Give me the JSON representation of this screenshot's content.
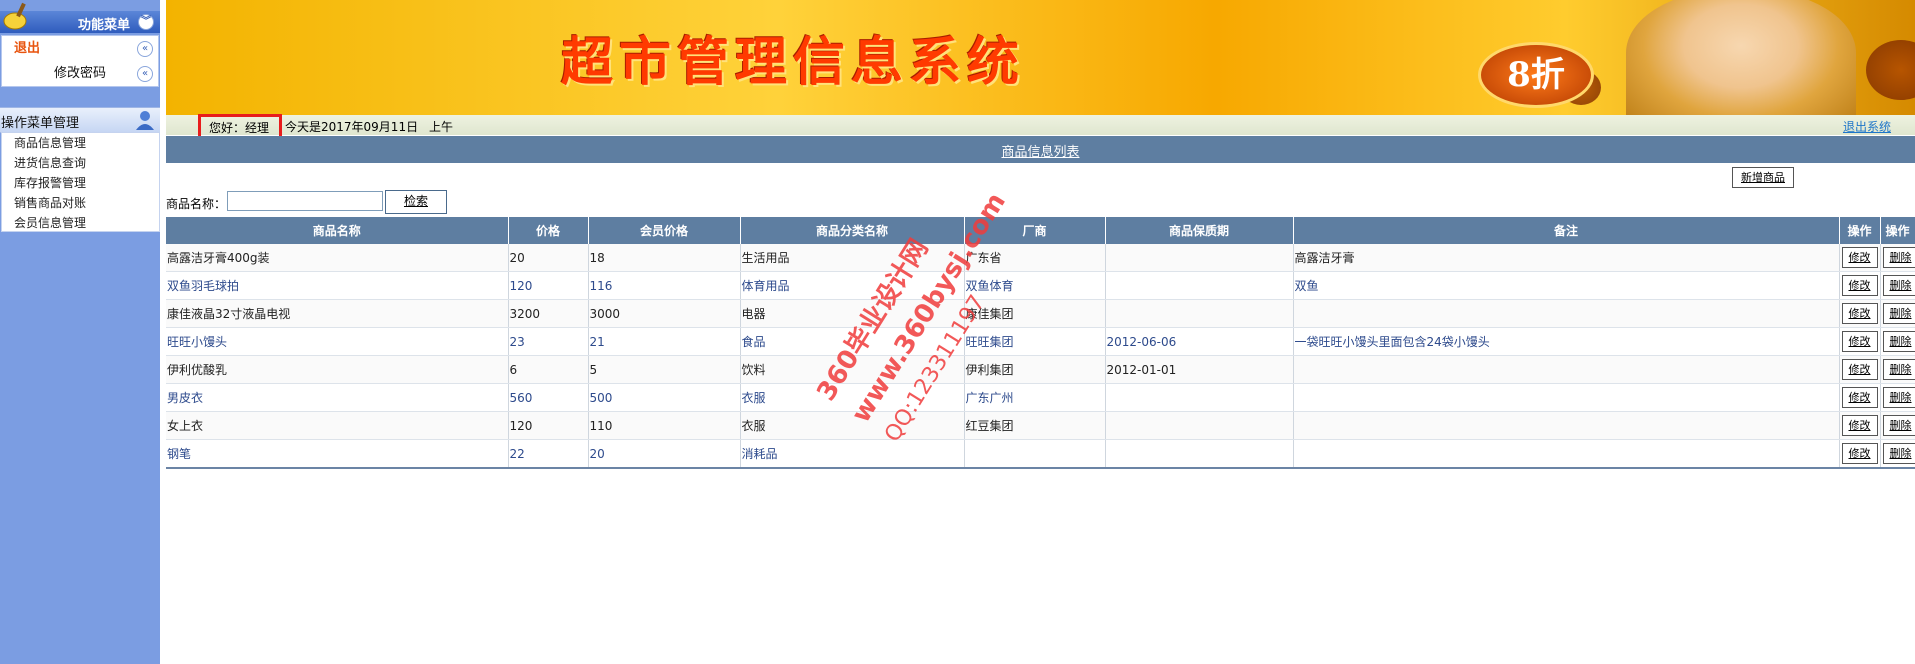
{
  "sidebar": {
    "function_menu_title": "功能菜单",
    "logout_label": "退出",
    "change_password_label": "修改密码",
    "op_menu_title": "操作菜单管理",
    "items": [
      {
        "label": "商品信息管理"
      },
      {
        "label": "进货信息查询"
      },
      {
        "label": "库存报警管理"
      },
      {
        "label": "销售商品对账"
      },
      {
        "label": "会员信息管理"
      }
    ]
  },
  "banner": {
    "title": "超市管理信息系统",
    "discount": "8折"
  },
  "greeting": {
    "hello": "您好：经理",
    "date": "今天是2017年09月11日",
    "ampm": "上午",
    "logout_link": "退出系统"
  },
  "section_title": "商品信息列表",
  "toolbar": {
    "add_button": "新增商品",
    "search_label": "商品名称：",
    "search_value": "",
    "search_button": "检索"
  },
  "table": {
    "headers": [
      "商品名称",
      "价格",
      "会员价格",
      "商品分类名称",
      "厂商",
      "商品保质期",
      "备注",
      "操作",
      "操作"
    ],
    "rows": [
      {
        "name": "高露洁牙膏400g装",
        "price": "20",
        "member_price": "18",
        "category": "生活用品",
        "maker": "广东省",
        "shelf": "",
        "note": "高露洁牙膏",
        "edit": "修改",
        "del": "删除"
      },
      {
        "name": "双鱼羽毛球拍",
        "price": "120",
        "member_price": "116",
        "category": "体育用品",
        "maker": "双鱼体育",
        "shelf": "",
        "note": "双鱼",
        "edit": "修改",
        "del": "删除"
      },
      {
        "name": "康佳液晶32寸液晶电视",
        "price": "3200",
        "member_price": "3000",
        "category": "电器",
        "maker": "康佳集团",
        "shelf": "",
        "note": "",
        "edit": "修改",
        "del": "删除"
      },
      {
        "name": "旺旺小馒头",
        "price": "23",
        "member_price": "21",
        "category": "食品",
        "maker": "旺旺集团",
        "shelf": "2012-06-06",
        "note": "一袋旺旺小馒头里面包含24袋小馒头",
        "edit": "修改",
        "del": "删除"
      },
      {
        "name": "伊利优酸乳",
        "price": "6",
        "member_price": "5",
        "category": "饮料",
        "maker": "伊利集团",
        "shelf": "2012-01-01",
        "note": "",
        "edit": "修改",
        "del": "删除"
      },
      {
        "name": "男皮衣",
        "price": "560",
        "member_price": "500",
        "category": "衣服",
        "maker": "广东广州",
        "shelf": "",
        "note": "",
        "edit": "修改",
        "del": "删除"
      },
      {
        "name": "女上衣",
        "price": "120",
        "member_price": "110",
        "category": "衣服",
        "maker": "红豆集团",
        "shelf": "",
        "note": "",
        "edit": "修改",
        "del": "删除"
      },
      {
        "name": "钢笔",
        "price": "22",
        "member_price": "20",
        "category": "消耗品",
        "maker": "",
        "shelf": "",
        "note": "",
        "edit": "修改",
        "del": "删除"
      }
    ]
  },
  "watermark": {
    "line1": "360毕业设计网",
    "line2": "www.360bysj.com",
    "line3": "QQ:123311197"
  }
}
